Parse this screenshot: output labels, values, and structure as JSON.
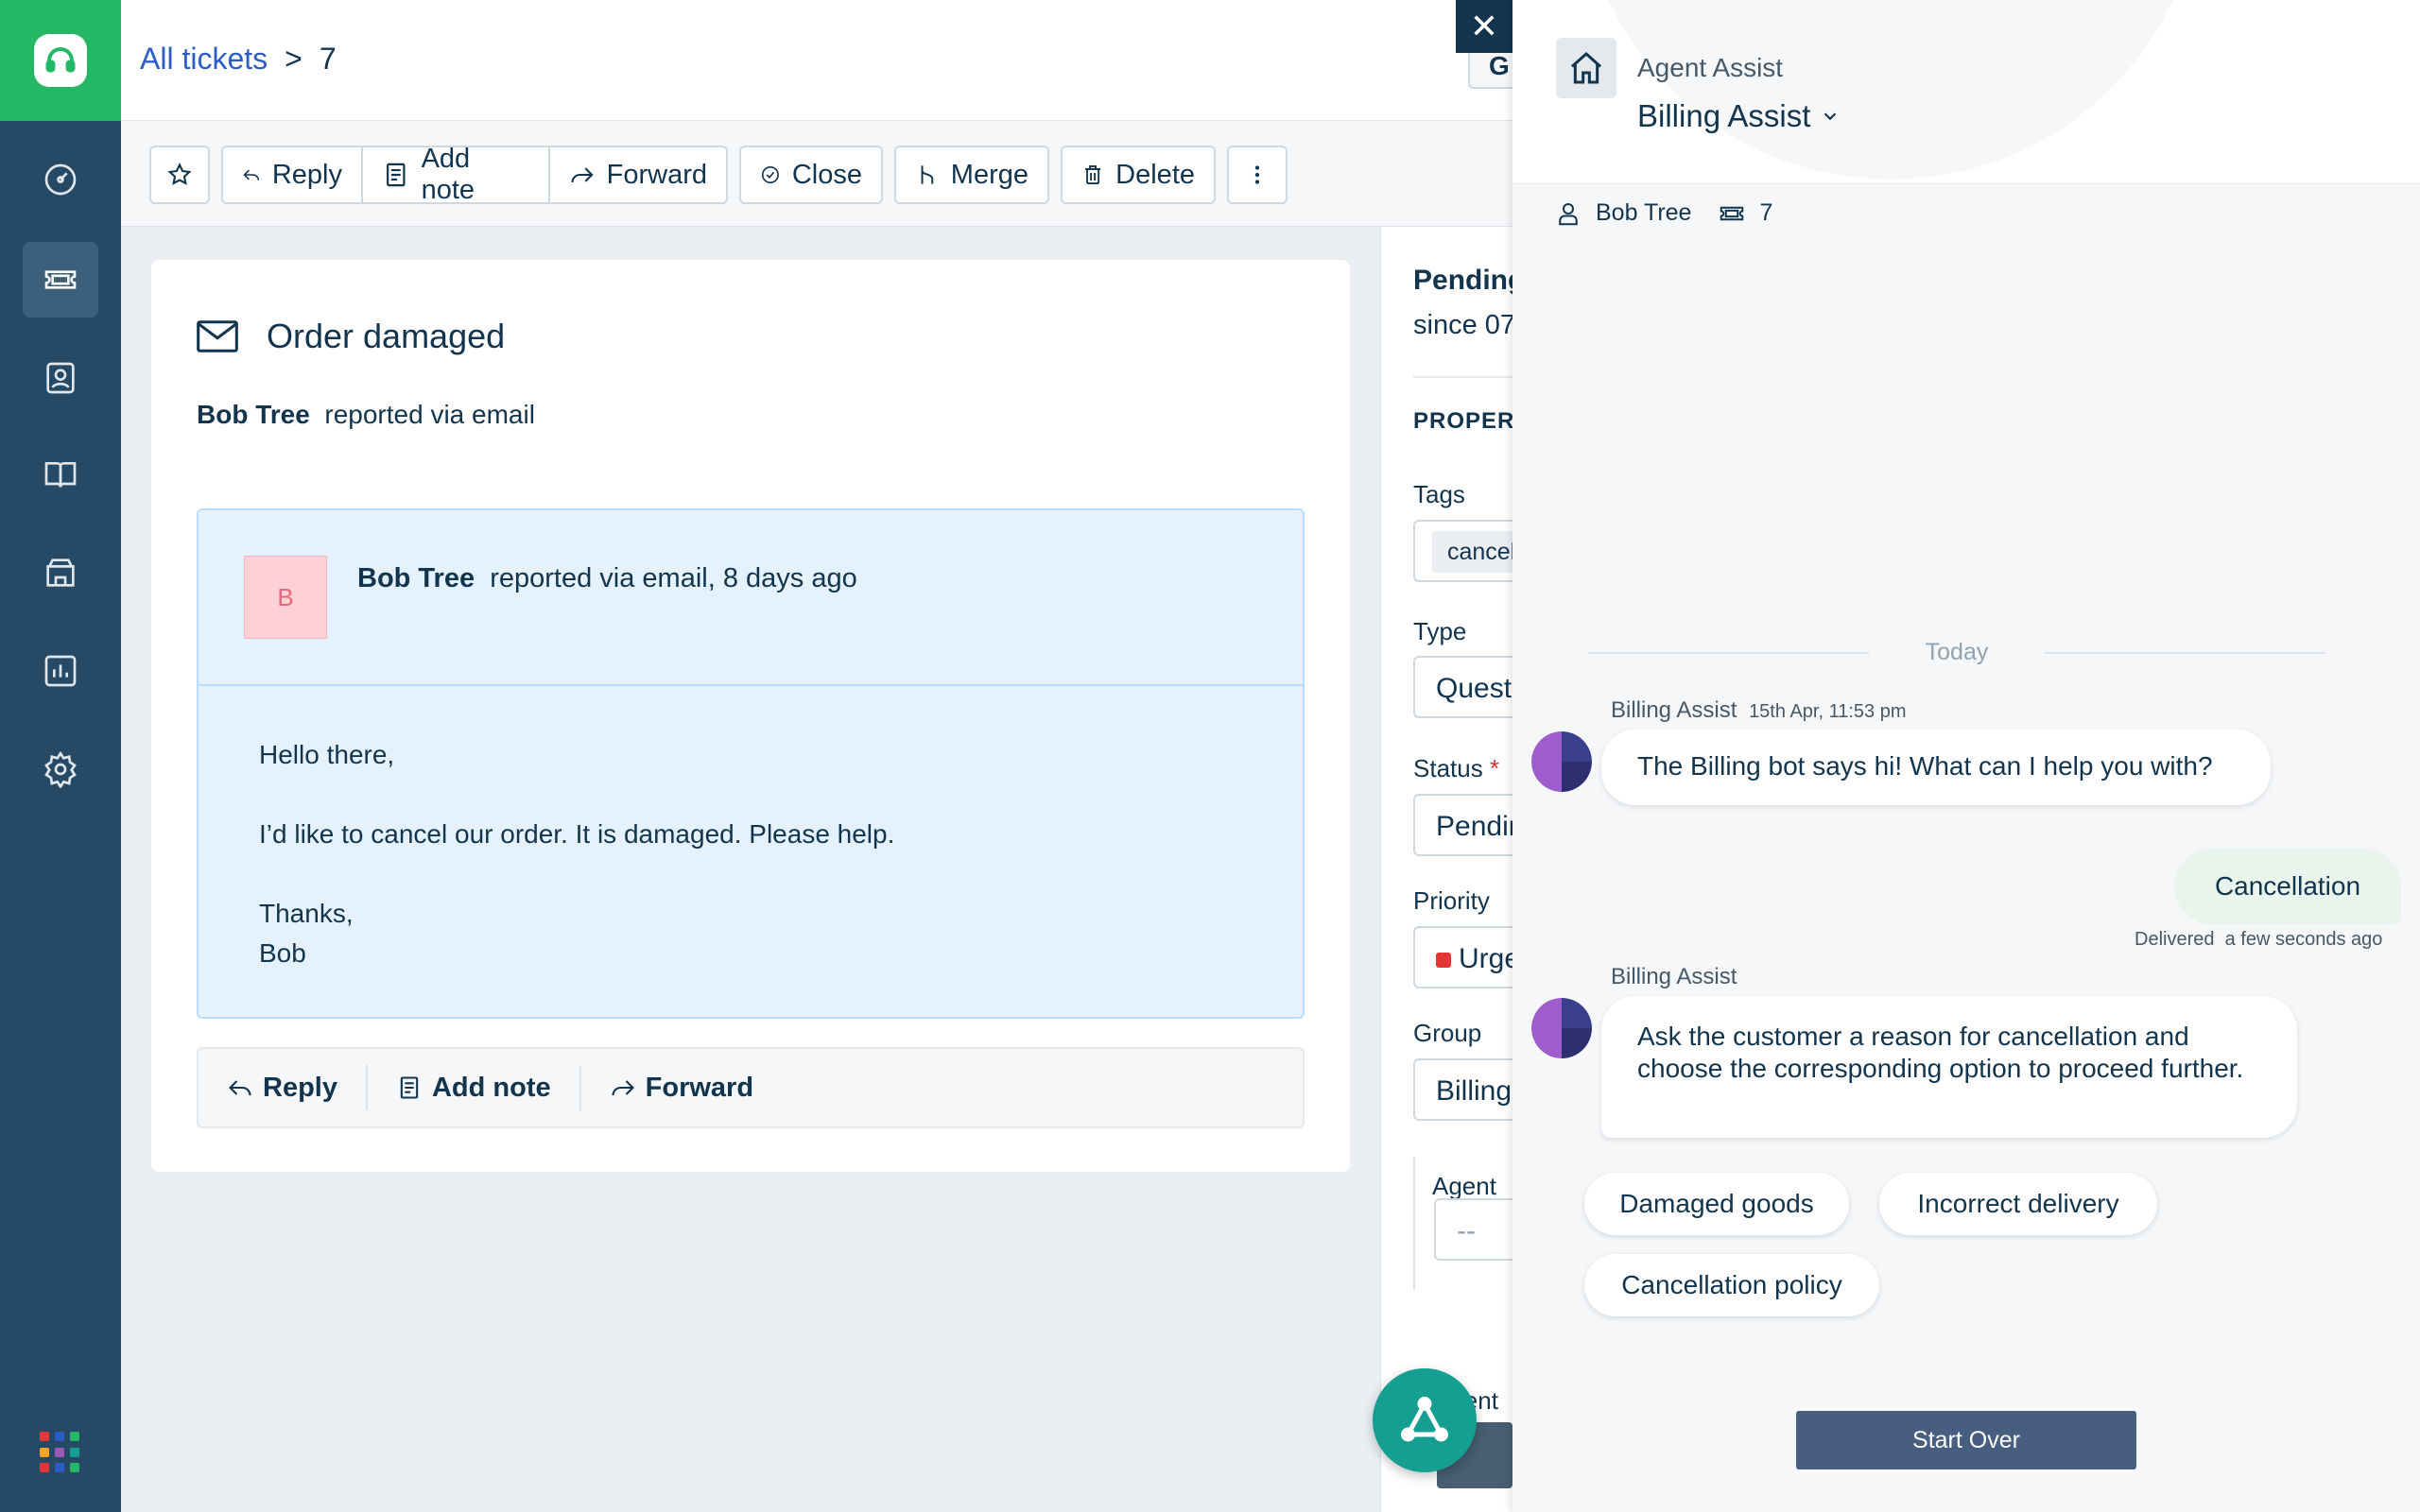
{
  "nav": {
    "items": [
      "dashboard-icon",
      "tickets-icon",
      "contacts-icon",
      "solutions-icon",
      "forums-icon",
      "reports-icon",
      "admin-icon"
    ],
    "apps_colors": [
      "#e43538",
      "#2c5cc5",
      "#25b768",
      "#f6a623",
      "#9b59b6",
      "#159e92",
      "#e43538",
      "#2c5cc5",
      "#25b768"
    ]
  },
  "header": {
    "breadcrumb_link": "All tickets",
    "breadcrumb_sep": ">",
    "ticket_id": "7",
    "partial_button": "G"
  },
  "toolbar": {
    "reply": "Reply",
    "add_note": "Add note",
    "forward": "Forward",
    "close": "Close",
    "merge": "Merge",
    "delete": "Delete"
  },
  "ticket": {
    "subject": "Order damaged",
    "requester": "Bob Tree",
    "reported_via": "reported via email",
    "message": {
      "avatar_letter": "B",
      "from": "Bob Tree",
      "meta": "reported via email, 8 days ago",
      "greeting": "Hello there,",
      "body": "I’d like to cancel our order. It is damaged. Please help.",
      "signoff": "Thanks,",
      "signature": "Bob"
    },
    "reply_bar": {
      "reply": "Reply",
      "add_note": "Add note",
      "forward": "Forward"
    }
  },
  "properties": {
    "status_title": "Pending",
    "since": "since 07",
    "header": "PROPERT",
    "tags_label": "Tags",
    "tag": "cancel",
    "type_label": "Type",
    "type_value": "Quest",
    "status_label": "Status",
    "required_mark": "*",
    "status_value": "Pendin",
    "priority_label": "Priority",
    "priority_value": "Urge",
    "group_label": "Group",
    "group_value": "Billing",
    "agent_label": "Agent",
    "agent_value": "--"
  },
  "assist": {
    "close": "✕",
    "title": "Agent Assist",
    "bot_name": "Billing Assist",
    "contact_name": "Bob Tree",
    "ticket_ref": "7",
    "day_divider": "Today",
    "messages": {
      "m1_sender": "Billing Assist",
      "m1_time": "15th Apr, 11:53 pm",
      "m1_text": "The Billing bot says hi! What can I help you with?",
      "user_reply": "Cancellation",
      "delivered": "Delivered",
      "delivered_time": "a few seconds ago",
      "m2_sender": "Billing Assist",
      "m2_text": "Ask the customer a reason for cancellation and choose the corresponding option to proceed further."
    },
    "options": [
      "Damaged goods",
      "Incorrect delivery",
      "Cancellation policy"
    ],
    "start_over": "Start Over"
  }
}
